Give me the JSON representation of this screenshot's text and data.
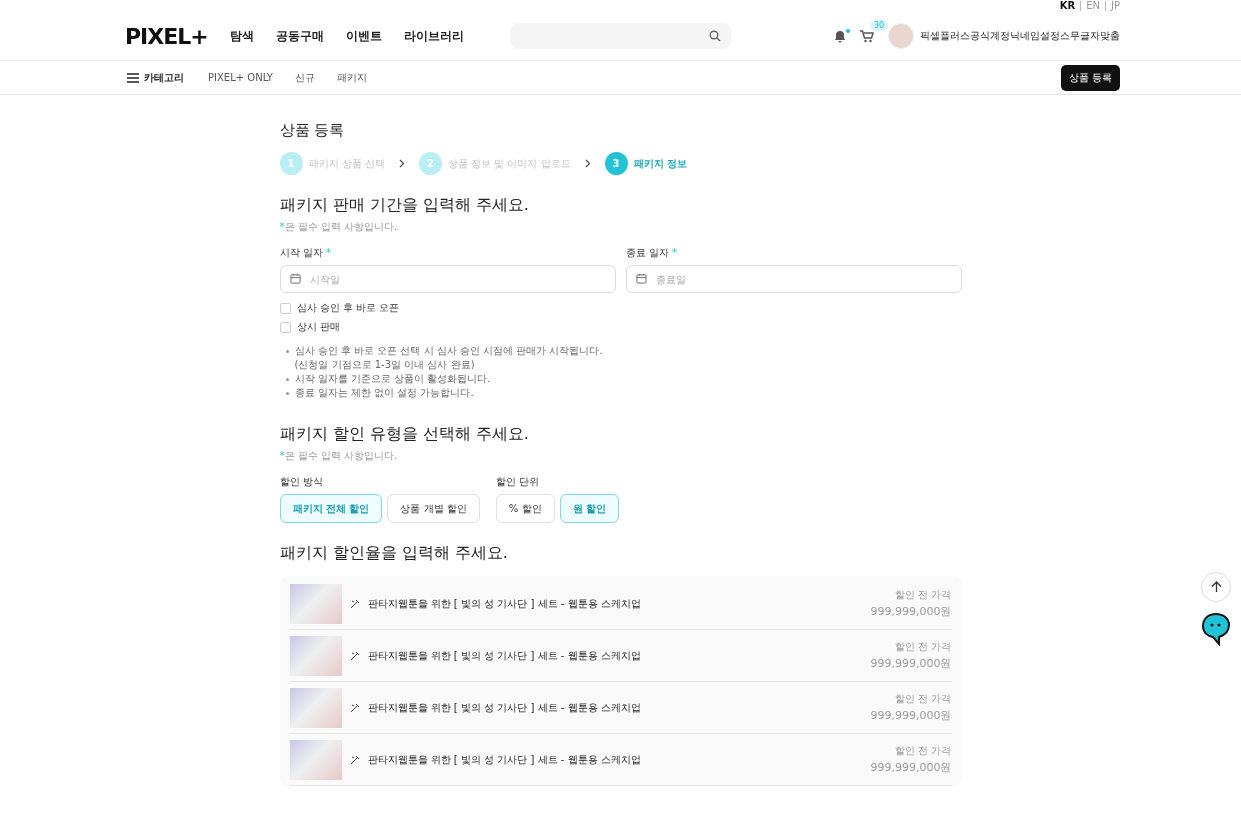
{
  "languages": [
    {
      "label": "KR",
      "selected": true
    },
    {
      "label": "EN",
      "selected": false
    },
    {
      "label": "JP",
      "selected": false
    }
  ],
  "header": {
    "logo": "PIXEL+",
    "nav": [
      "탐색",
      "공동구매",
      "이벤트",
      "라이브러리"
    ],
    "notification_dot": true,
    "cart_count": "30",
    "username": "픽셀플러스공식계정닉네임설정스무글자맞춤"
  },
  "subnav": {
    "category": "카테고리",
    "links": [
      "PIXEL+ ONLY",
      "신규",
      "패키지"
    ],
    "register_button": "상품 등록"
  },
  "page_title": "상품 등록",
  "steps": [
    {
      "number": "1",
      "label": "패키지 상품 선택",
      "selected": false
    },
    {
      "number": "2",
      "label": "상품 정보 및 이미지 업로드",
      "selected": false
    },
    {
      "number": "3",
      "label": "패키지 정보",
      "selected": true
    }
  ],
  "period_section": {
    "heading": "패키지 판매 기간을 입력해 주세요.",
    "required_mark": "*",
    "required_note": "은 필수 입력 사항입니다.",
    "start": {
      "label": "시작 일자",
      "required_mark": "*",
      "placeholder": "시작일"
    },
    "end": {
      "label": "종료 일자",
      "required_mark": "*",
      "placeholder": "종료일"
    },
    "options": [
      {
        "label": "심사 승인 후 바로 오픈",
        "checked": false
      },
      {
        "label": "상시 판매",
        "checked": false
      }
    ],
    "notes": [
      {
        "lines": [
          "심사 승인 후 바로 오픈 선택 시 심사 승인 시점에 판매가 시작됩니다.",
          "(신청일 기점으로 1-3일 이내 심사 완료)"
        ]
      },
      {
        "lines": [
          "시작 일자를 기준으로 상품이 활성화됩니다."
        ]
      },
      {
        "lines": [
          "종료 일자는 제한 없이 설정 가능합니다."
        ]
      }
    ]
  },
  "discount_section": {
    "heading": "패키지 할인 유형을 선택해 주세요.",
    "required_mark": "*",
    "required_note": "은 필수 입력 사항입니다.",
    "groups": [
      {
        "label": "할인 방식",
        "options": [
          {
            "label": "패키지 전체 할인",
            "selected": true
          },
          {
            "label": "상품 개별 할인",
            "selected": false
          }
        ]
      },
      {
        "label": "할인 단위",
        "options": [
          {
            "label": "% 할인",
            "selected": false
          },
          {
            "label": "원 할인",
            "selected": true
          }
        ]
      }
    ]
  },
  "rate_section": {
    "heading": "패키지 할인율을 입력해 주세요.",
    "products": [
      {
        "name": "판타지웹툰을 위한 [ 빛의 성 기사단 ] 세트 - 웹툰용 스케치업",
        "price_label": "할인 전 가격",
        "price": "999,999,000원"
      },
      {
        "name": "판타지웹툰을 위한 [ 빛의 성 기사단 ] 세트 - 웹툰용 스케치업",
        "price_label": "할인 전 가격",
        "price": "999,999,000원"
      },
      {
        "name": "판타지웹툰을 위한 [ 빛의 성 기사단 ] 세트 - 웹툰용 스케치업",
        "price_label": "할인 전 가격",
        "price": "999,999,000원"
      },
      {
        "name": "판타지웹툰을 위한 [ 빛의 성 기사단 ] 세트 - 웹툰용 스케치업",
        "price_label": "할인 전 가격",
        "price": "999,999,000원"
      }
    ]
  }
}
